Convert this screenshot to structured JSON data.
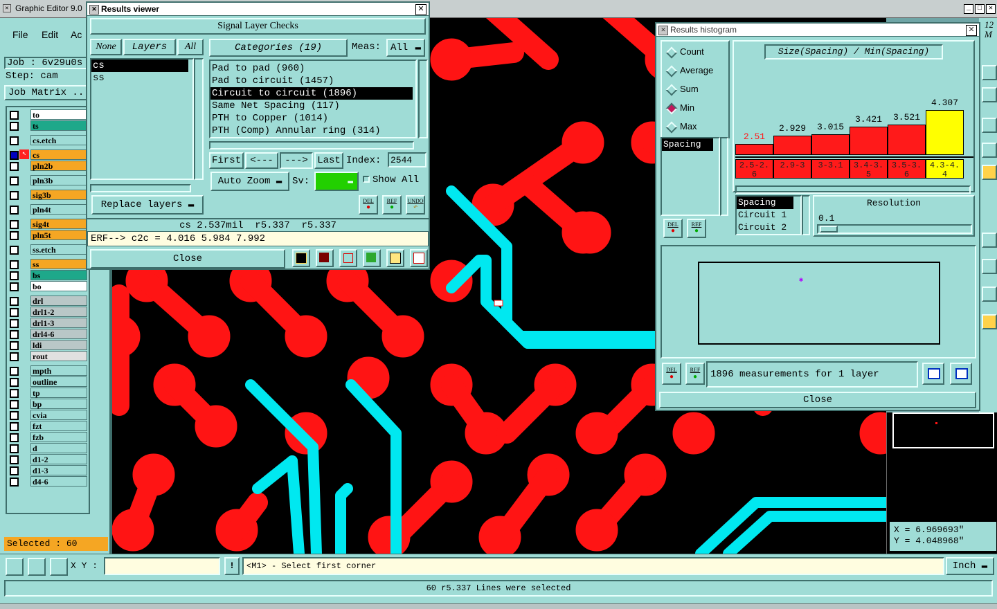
{
  "main_window": {
    "title": "Graphic Editor 9.0"
  },
  "menu": {
    "file": "File",
    "edit": "Edit",
    "actions": "Ac"
  },
  "job": {
    "job_label": "Job : 6v29u0s",
    "step_label": "Step: cam",
    "matrix_button": "Job Matrix ..."
  },
  "layers": [
    {
      "name": "to",
      "color": "#ffffff"
    },
    {
      "name": "ts",
      "color": "#1ea88a"
    },
    {
      "name": "cs.etch",
      "color": "#9fdcd6"
    },
    {
      "name": "cs",
      "color": "#f5a623"
    },
    {
      "name": "pln2b",
      "color": "#f5a623"
    },
    {
      "name": "pln3b",
      "color": "#9fdcd6"
    },
    {
      "name": "sig3b",
      "color": "#f5a623"
    },
    {
      "name": "pln4t",
      "color": "#9fdcd6"
    },
    {
      "name": "sig4t",
      "color": "#f5a623"
    },
    {
      "name": "pln5t",
      "color": "#f5a623"
    },
    {
      "name": "ss.etch",
      "color": "#9fdcd6"
    },
    {
      "name": "ss",
      "color": "#f5a623"
    },
    {
      "name": "bs",
      "color": "#1ea88a"
    },
    {
      "name": "bo",
      "color": "#ffffff"
    },
    {
      "name": "drl",
      "color": "#b9c7c7"
    },
    {
      "name": "drl1-2",
      "color": "#b9c7c7"
    },
    {
      "name": "drl1-3",
      "color": "#b9c7c7"
    },
    {
      "name": "drl4-6",
      "color": "#b9c7c7"
    },
    {
      "name": "ldi",
      "color": "#b9c7c7"
    },
    {
      "name": "rout",
      "color": "#e0e0e0"
    },
    {
      "name": "mpth",
      "color": "#9fdcd6"
    },
    {
      "name": "outline",
      "color": "#9fdcd6"
    },
    {
      "name": "tp",
      "color": "#9fdcd6"
    },
    {
      "name": "bp",
      "color": "#9fdcd6"
    },
    {
      "name": "cvia",
      "color": "#9fdcd6"
    },
    {
      "name": "fzt",
      "color": "#9fdcd6"
    },
    {
      "name": "fzb",
      "color": "#9fdcd6"
    },
    {
      "name": "d",
      "color": "#9fdcd6"
    },
    {
      "name": "d1-2",
      "color": "#9fdcd6"
    },
    {
      "name": "d1-3",
      "color": "#9fdcd6"
    },
    {
      "name": "d4-6",
      "color": "#9fdcd6"
    }
  ],
  "status": {
    "selected": "Selected : 60",
    "message": "60 r5.337 Lines were selected"
  },
  "coord_bar": {
    "xy_label": "X Y :",
    "input_value": "",
    "hint": "<M1> - Select first corner",
    "units": "Inch"
  },
  "coords": {
    "x": "X = 6.969693\"",
    "y": "Y = 4.048968\""
  },
  "results_viewer": {
    "title": "Results viewer",
    "header": "Signal Layer Checks",
    "layer_buttons": {
      "none": "None",
      "layers": "Layers",
      "all": "All"
    },
    "layer_list": [
      "cs",
      "ss"
    ],
    "categories_label": "Categories (19)",
    "meas_label": "Meas:",
    "meas_value": "All",
    "categories": [
      "Pad to pad (960)",
      "Pad to circuit (1457)",
      "Circuit to circuit (1896)",
      "Same Net Spacing (117)",
      "PTH to Copper (1014)",
      "PTH (Comp) Annular ring (314)"
    ],
    "nav": {
      "first": "First",
      "prev": "<---",
      "next": "--->",
      "last": "Last",
      "index_label": "Index:",
      "index_value": "2544"
    },
    "auto_zoom": "Auto Zoom",
    "sv_label": "Sv:",
    "show_all": "Show All",
    "replace_layers": "Replace layers",
    "del": "DEL",
    "ref": "REF",
    "undo": "UNDO",
    "info_line": "cs 2.537mil  r5.337  r5.337",
    "erf_line": "ERF--> c2c = 4.016 5.984 7.992",
    "close": "Close"
  },
  "histogram": {
    "title": "Results histogram",
    "modes": [
      "Count",
      "Average",
      "Sum",
      "Min",
      "Max"
    ],
    "selected_mode": "Min",
    "heading": "Size(Spacing) / Min(Spacing)",
    "bars": [
      {
        "value": "2.51",
        "range": "2.5-2.6",
        "highlight": false
      },
      {
        "value": "2.929",
        "range": "2.9-3",
        "highlight": false
      },
      {
        "value": "3.015",
        "range": "3-3.1",
        "highlight": false
      },
      {
        "value": "3.421",
        "range": "3.4-3.5",
        "highlight": false
      },
      {
        "value": "3.521",
        "range": "3.5-3.6",
        "highlight": false
      },
      {
        "value": "4.307",
        "range": "4.3-4.4",
        "highlight": true
      }
    ],
    "attr_list": [
      "Spacing"
    ],
    "detail_list": [
      "Spacing",
      "Circuit 1",
      "Circuit 2"
    ],
    "resolution_label": "Resolution",
    "resolution_value": "0.1",
    "summary": "1896 measurements for 1 layer",
    "del": "DEL",
    "ref": "REF",
    "close": "Close"
  },
  "right_edge": {
    "clip_text_1": "12",
    "clip_text_2": "M"
  }
}
